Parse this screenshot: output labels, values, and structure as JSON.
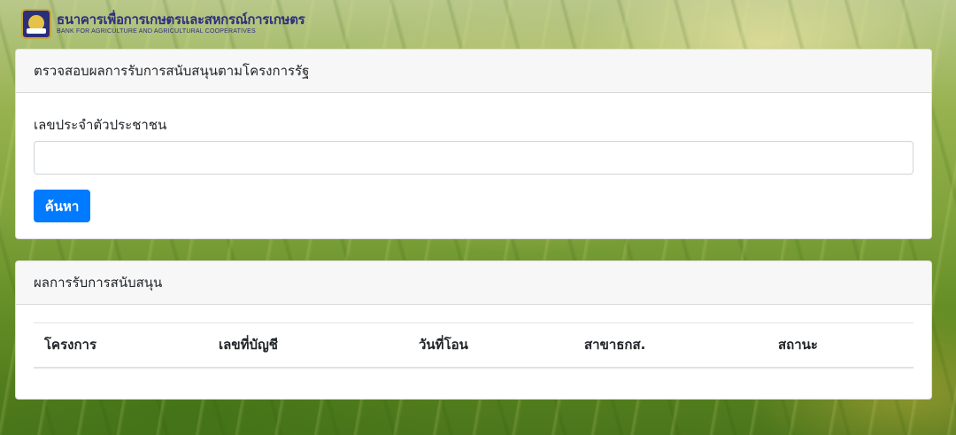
{
  "brand": {
    "name_th": "ธนาคารเพื่อการเกษตรและสหกรณ์การเกษตร",
    "name_en": "BANK FOR AGRICULTURE AND AGRICULTURAL COOPERATIVES"
  },
  "search_card": {
    "title": "ตรวจสอบผลการรับการสนับสนุนตามโครงการรัฐ",
    "id_label": "เลขประจำตัวประชาชน",
    "id_value": "",
    "search_button": "ค้นหา"
  },
  "result_card": {
    "title": "ผลการรับการสนับสนุน",
    "columns": [
      "โครงการ",
      "เลขที่บัญชี",
      "วันที่โอน",
      "สาขาธกส.",
      "สถานะ"
    ]
  }
}
